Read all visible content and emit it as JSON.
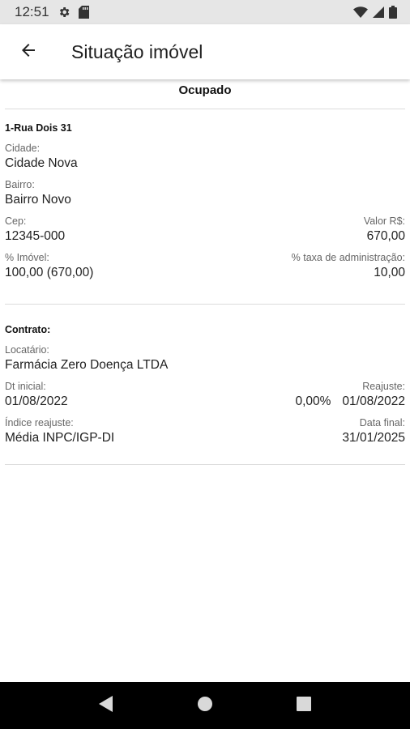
{
  "status_bar": {
    "time": "12:51"
  },
  "app_bar": {
    "title": "Situação imóvel"
  },
  "situation": {
    "status": "Ocupado"
  },
  "property": {
    "title": "1-Rua Dois 31",
    "cidade_label": "Cidade:",
    "cidade": "Cidade Nova",
    "bairro_label": "Bairro:",
    "bairro": "Bairro Novo",
    "cep_label": "Cep:",
    "cep": "12345-000",
    "valor_label": "Valor R$:",
    "valor": "670,00",
    "pct_imovel_label": "% Imóvel:",
    "pct_imovel": "100,00 (670,00)",
    "taxa_label": "% taxa de administração:",
    "taxa": "10,00"
  },
  "contract": {
    "title": "Contrato:",
    "locatario_label": "Locatário:",
    "locatario": "Farmácia Zero Doença LTDA",
    "dt_inicial_label": "Dt inicial:",
    "dt_inicial": "01/08/2022",
    "reajuste_label": "Reajuste:",
    "reajuste_pct": "0,00%",
    "reajuste_date": "01/08/2022",
    "indice_label": "Índice reajuste:",
    "indice": "Média INPC/IGP-DI",
    "data_final_label": "Data final:",
    "data_final": "31/01/2025"
  },
  "colors": {
    "status_bar": "#e6e6e6",
    "nav_bar": "#000000",
    "divider": "#dcdcdc"
  }
}
